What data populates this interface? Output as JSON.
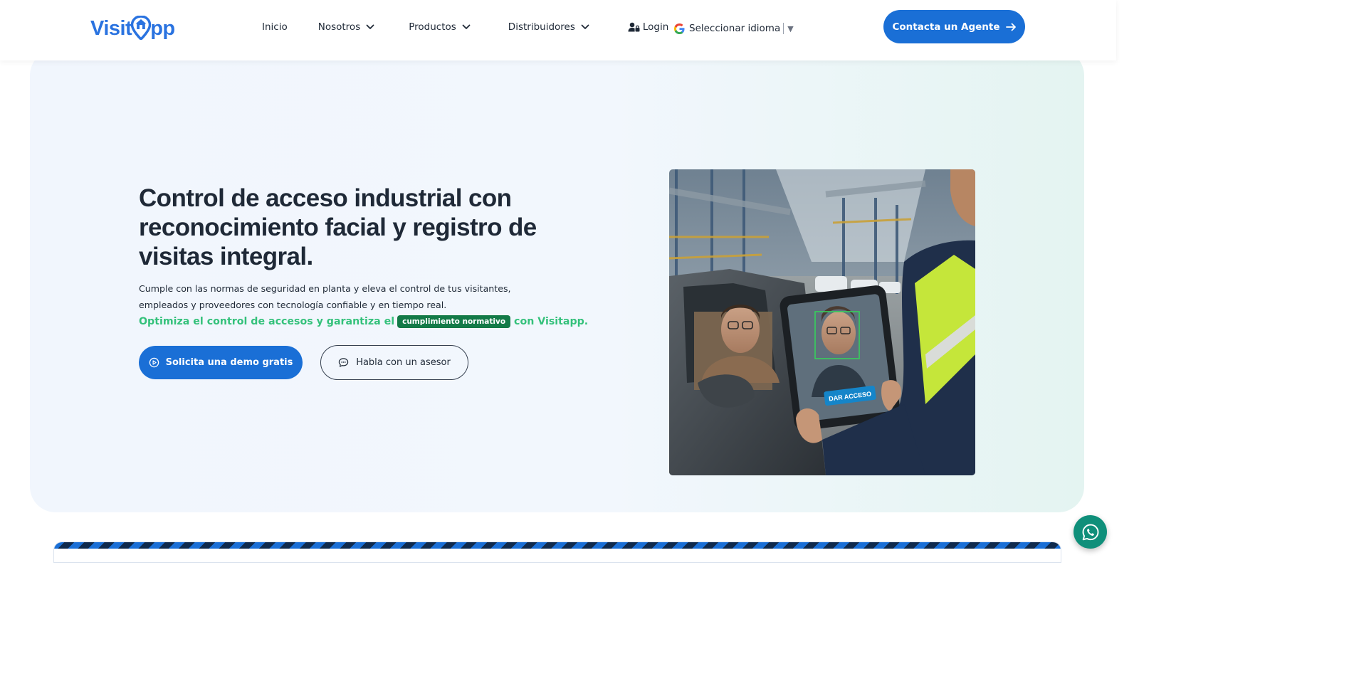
{
  "header": {
    "logo_left": "Visit",
    "logo_right": "pp",
    "nav": [
      {
        "label": "Inicio"
      },
      {
        "label": "Nosotros"
      },
      {
        "label": "Productos"
      },
      {
        "label": "Distribuidores"
      }
    ],
    "login_label": "Login",
    "language_label": "Seleccionar idioma",
    "language_arrow": "▼",
    "cta_label": "Contacta un Agente"
  },
  "hero": {
    "title": "Control de acceso industrial con reconocimiento facial y registro de visitas integral.",
    "subtitle": "Cumple con las normas de seguridad en planta y eleva el control de tus visitantes, empleados y proveedores con tecnología confiable y en tiempo real.",
    "green_prefix": "Optimiza el control de accesos y garantiza el",
    "badge": "cumplimiento normativo",
    "green_suffix": "con Visitapp.",
    "demo_button": "Solicita una demo gratis",
    "advisor_button": "Habla con un asesor",
    "tablet_label": "DAR ACCESO"
  },
  "colors": {
    "primary": "#1a6fd6",
    "green": "#34c17b",
    "badge": "#137a47",
    "whatsapp": "#0f8f7a"
  },
  "icons": [
    "chevron-down-icon",
    "user-lock-icon",
    "google-icon",
    "arrow-right-icon",
    "play-circle-icon",
    "chat-bubble-icon",
    "whatsapp-icon"
  ]
}
